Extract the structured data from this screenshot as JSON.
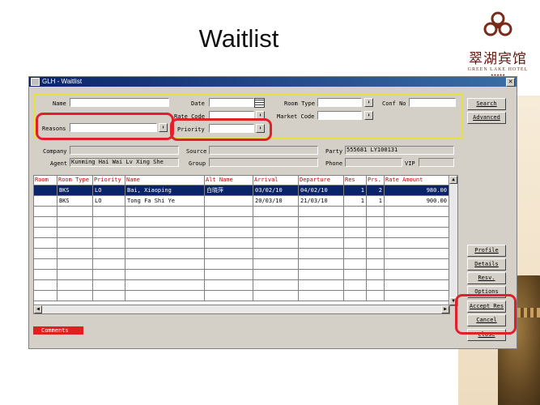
{
  "slide": {
    "title": "Waitlist"
  },
  "logo": {
    "chinese": "翠湖宾馆",
    "english": "GREEN LAKE HOTEL",
    "stars": "★★★★★"
  },
  "window": {
    "title": "GLH - Waitlist",
    "close": "✕"
  },
  "form": {
    "name_label": "Name",
    "name_value": "",
    "date_label": "Date",
    "date_value": "",
    "room_type_label": "Room Type",
    "room_type_value": "",
    "conf_no_label": "Conf No",
    "conf_no_value": "",
    "rate_code_label": "Rate Code",
    "rate_code_value": "",
    "market_code_label": "Market Code",
    "market_code_value": "",
    "reasons_label": "Reasons",
    "reasons_value": "",
    "priority_label": "Priority",
    "priority_value": ""
  },
  "details": {
    "company_label": "Company",
    "company_value": "",
    "source_label": "Source",
    "source_value": "",
    "party_label": "Party",
    "party_value": "555681 LY100131",
    "agent_label": "Agent",
    "agent_value": "Kunming Hai Wai Lv Xing She",
    "group_label": "Group",
    "group_value": "",
    "phone_label": "Phone",
    "phone_value": "",
    "vip_label": "VIP",
    "vip_value": ""
  },
  "grid": {
    "columns": [
      "Room",
      "Room Type",
      "Priority",
      "Name",
      "Alt Name",
      "Arrival",
      "Departure",
      "Res",
      "Prs.",
      "Rate Amount"
    ],
    "rows": [
      {
        "room": "",
        "room_type": "BKS",
        "priority": "LO",
        "name": "Bai, Xiaoping",
        "alt_name": "白晓萍",
        "arrival": "03/02/10",
        "departure": "04/02/10",
        "res": "1",
        "prs": "2",
        "rate": "980.00"
      },
      {
        "room": "",
        "room_type": "BKS",
        "priority": "LO",
        "name": "Tong Fa Shi Ye",
        "alt_name": "",
        "arrival": "20/03/10",
        "departure": "21/03/10",
        "res": "1",
        "prs": "1",
        "rate": "900.00"
      }
    ]
  },
  "buttons": {
    "search": "Search",
    "advanced": "Advanced",
    "profile": "Profile",
    "details": "Details",
    "resv": "Resv.",
    "options": "Options",
    "accept_res": "Accept Res",
    "cancel": "Cancel",
    "close": "Close"
  },
  "comments": "Comments",
  "colors": {
    "highlight_red": "#e0202a",
    "frame_yellow": "#e8e040",
    "selected_row": "#0a246a"
  }
}
